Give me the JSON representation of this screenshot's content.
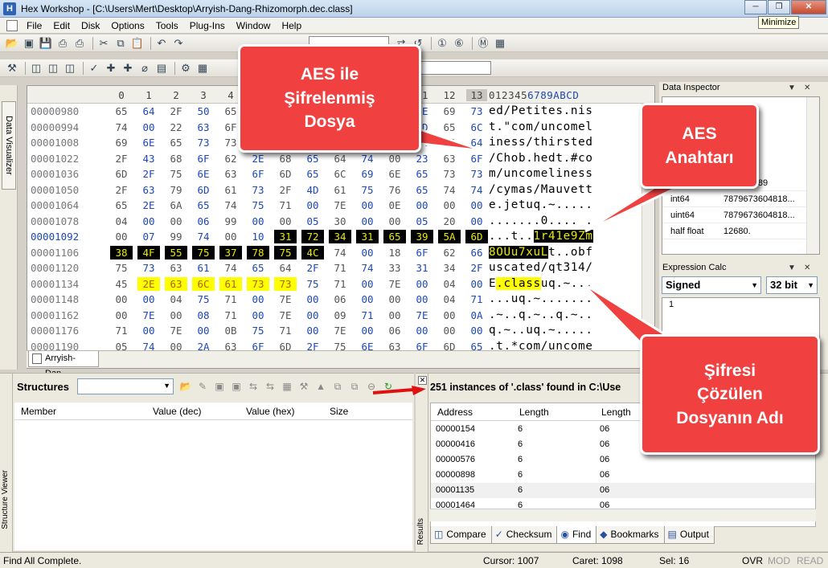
{
  "window": {
    "title": "Hex Workshop - [C:\\Users\\Mert\\Desktop\\Arryish-Dang-Rhizomorph.dec.class]",
    "tooltip": "Minimize"
  },
  "menu": [
    "File",
    "Edit",
    "Disk",
    "Options",
    "Tools",
    "Plug-Ins",
    "Window",
    "Help"
  ],
  "left_tab": "Data Visualizer",
  "hex": {
    "column_headers": [
      "0",
      "1",
      "2",
      "3",
      "4",
      "5",
      "6",
      "7",
      "8",
      "9",
      "10",
      "11",
      "12",
      "13"
    ],
    "char_header_a": "012345",
    "char_header_b": "6789ABCD",
    "rows": [
      {
        "offset": "00000980",
        "bytes": [
          "65",
          "64",
          "2F",
          "50",
          "65",
          "74",
          "69",
          "74",
          "65",
          "73",
          "2E",
          "6E",
          "69",
          "73"
        ],
        "chars": "ed/Petites.nis"
      },
      {
        "offset": "00000994",
        "bytes": [
          "74",
          "00",
          "22",
          "63",
          "6F",
          "6D",
          "2F",
          "75",
          "6E",
          "63",
          "6F",
          "6D",
          "65",
          "6C"
        ],
        "chars": "t.\"com/uncomel"
      },
      {
        "offset": "00001008",
        "bytes": [
          "69",
          "6E",
          "65",
          "73",
          "73",
          "2F",
          "74",
          "68",
          "69",
          "72",
          "73",
          "74",
          "65",
          "64"
        ],
        "chars": "iness/thirsted"
      },
      {
        "offset": "00001022",
        "bytes": [
          "2F",
          "43",
          "68",
          "6F",
          "62",
          "2E",
          "68",
          "65",
          "64",
          "74",
          "00",
          "23",
          "63",
          "6F"
        ],
        "chars": "/Chob.hedt.#co"
      },
      {
        "offset": "00001036",
        "bytes": [
          "6D",
          "2F",
          "75",
          "6E",
          "63",
          "6F",
          "6D",
          "65",
          "6C",
          "69",
          "6E",
          "65",
          "73",
          "73"
        ],
        "chars": "m/uncomeliness"
      },
      {
        "offset": "00001050",
        "bytes": [
          "2F",
          "63",
          "79",
          "6D",
          "61",
          "73",
          "2F",
          "4D",
          "61",
          "75",
          "76",
          "65",
          "74",
          "74"
        ],
        "chars": "/cymas/Mauvett"
      },
      {
        "offset": "00001064",
        "bytes": [
          "65",
          "2E",
          "6A",
          "65",
          "74",
          "75",
          "71",
          "00",
          "7E",
          "00",
          "0E",
          "00",
          "00",
          "00"
        ],
        "chars": "e.jetuq.~....."
      },
      {
        "offset": "00001078",
        "bytes": [
          "04",
          "00",
          "00",
          "06",
          "99",
          "00",
          "00",
          "05",
          "30",
          "00",
          "00",
          "05",
          "20",
          "00"
        ],
        "chars": ".......0.... ."
      },
      {
        "offset": "00001092",
        "bytes": [
          "00",
          "07",
          "99",
          "74",
          "00",
          "10",
          "31",
          "72",
          "34",
          "31",
          "65",
          "39",
          "5A",
          "6D"
        ],
        "chars": "...t..1r41e9Zm"
      },
      {
        "offset": "00001106",
        "bytes": [
          "38",
          "4F",
          "55",
          "75",
          "37",
          "78",
          "75",
          "4C",
          "74",
          "00",
          "18",
          "6F",
          "62",
          "66"
        ],
        "chars": "8OUu7xuLt..obf"
      },
      {
        "offset": "00001120",
        "bytes": [
          "75",
          "73",
          "63",
          "61",
          "74",
          "65",
          "64",
          "2F",
          "71",
          "74",
          "33",
          "31",
          "34",
          "2F"
        ],
        "chars": "uscated/qt314/"
      },
      {
        "offset": "00001134",
        "bytes": [
          "45",
          "2E",
          "63",
          "6C",
          "61",
          "73",
          "73",
          "75",
          "71",
          "00",
          "7E",
          "00",
          "04",
          "00"
        ],
        "chars": "E.classuq.~..."
      },
      {
        "offset": "00001148",
        "bytes": [
          "00",
          "00",
          "04",
          "75",
          "71",
          "00",
          "7E",
          "00",
          "06",
          "00",
          "00",
          "00",
          "04",
          "71"
        ],
        "chars": "...uq.~......."
      },
      {
        "offset": "00001162",
        "bytes": [
          "00",
          "7E",
          "00",
          "08",
          "71",
          "00",
          "7E",
          "00",
          "09",
          "71",
          "00",
          "7E",
          "00",
          "0A"
        ],
        "chars": ".~..q.~..q.~.."
      },
      {
        "offset": "00001176",
        "bytes": [
          "71",
          "00",
          "7E",
          "00",
          "0B",
          "75",
          "71",
          "00",
          "7E",
          "00",
          "06",
          "00",
          "00",
          "00"
        ],
        "chars": "q.~..uq.~....."
      },
      {
        "offset": "00001190",
        "bytes": [
          "05",
          "74",
          "00",
          "2A",
          "63",
          "6F",
          "6D",
          "2F",
          "75",
          "6E",
          "63",
          "6F",
          "6D",
          "65"
        ],
        "chars": ".t.*com/uncome"
      }
    ]
  },
  "doc_tab": "Arryish-Dan...",
  "data_inspector": {
    "title": "Data Inspector",
    "rows": [
      {
        "type": "uint32",
        "value": "825520689"
      },
      {
        "type": "int64",
        "value": "7879673604818..."
      },
      {
        "type": "uint64",
        "value": "7879673604818..."
      },
      {
        "type": "half float",
        "value": "12680."
      }
    ]
  },
  "expression_calc": {
    "title": "Expression Calc",
    "mode": "Signed",
    "width": "32 bit",
    "line": "1"
  },
  "structures": {
    "label": "Structures",
    "columns": [
      "Member",
      "Value (dec)",
      "Value (hex)",
      "Size"
    ],
    "side_label": "Structure Viewer"
  },
  "results": {
    "title": "251 instances of '.class' found in C:\\Use",
    "side_label": "Results",
    "columns": [
      "Address",
      "Length",
      "Length"
    ],
    "rows": [
      {
        "address": "00000154",
        "len1": "6",
        "len2": "06"
      },
      {
        "address": "00000416",
        "len1": "6",
        "len2": "06"
      },
      {
        "address": "00000576",
        "len1": "6",
        "len2": "06"
      },
      {
        "address": "00000898",
        "len1": "6",
        "len2": "06"
      },
      {
        "address": "00001135",
        "len1": "6",
        "len2": "06"
      },
      {
        "address": "00001464",
        "len1": "6",
        "len2": "06"
      }
    ],
    "tabs": [
      "Compare",
      "Checksum",
      "Find",
      "Bookmarks",
      "Output"
    ]
  },
  "status": {
    "message": "Find All Complete.",
    "cursor": "Cursor: 1007",
    "caret": "Caret: 1098",
    "sel": "Sel: 16",
    "ovr": "OVR",
    "mod": "MOD",
    "read": "READ"
  },
  "callouts": {
    "aes_file": "AES ile Şifrelenmiş Dosya",
    "aes_key": "AES Anahtarı",
    "decrypted_name": "Şifresi Çözülen Dosyanın Adı"
  },
  "colors": {
    "callout": "#f04040",
    "selection_bg": "#000000",
    "selection_fg": "#e8e800",
    "find_bg": "#ffff00",
    "offset_blue": "#1c48b8"
  }
}
